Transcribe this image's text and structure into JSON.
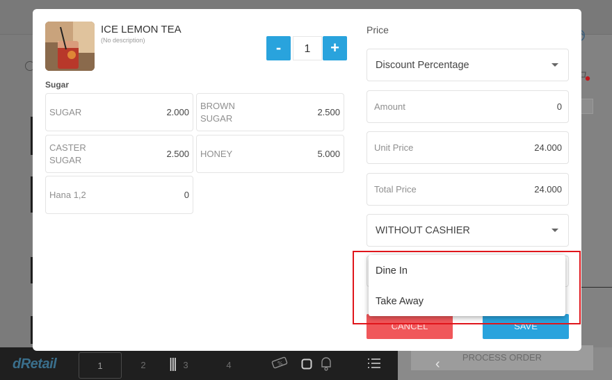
{
  "product": {
    "name": "ICE LEMON TEA",
    "description": "(No description)",
    "quantity": "1",
    "minus": "-",
    "plus": "+"
  },
  "option_group": {
    "label": "Sugar",
    "options": [
      {
        "name": "SUGAR",
        "price": "2.000"
      },
      {
        "name": "BROWN SUGAR",
        "price": "2.500"
      },
      {
        "name": "CASTER SUGAR",
        "price": "2.500"
      },
      {
        "name": "HONEY",
        "price": "5.000"
      },
      {
        "name": "Hana 1,2",
        "price": "0"
      }
    ]
  },
  "price_panel": {
    "label": "Price",
    "discount_type": "Discount Percentage",
    "amount_label": "Amount",
    "amount_value": "0",
    "unit_price_label": "Unit Price",
    "unit_price_value": "24.000",
    "total_price_label": "Total Price",
    "total_price_value": "24.000",
    "cashier_select": "WITHOUT CASHIER"
  },
  "order_type_dropdown": {
    "options": [
      "Dine In",
      "Take Away"
    ]
  },
  "actions": {
    "cancel": "CANCEL",
    "save": "SAVE"
  },
  "bottom_bar": {
    "brand": "dRetail",
    "pages": [
      "1",
      "2",
      "3",
      "4"
    ],
    "process_order": "PROCESS ORDER"
  },
  "colors": {
    "accent_blue": "#29a3dd",
    "cancel_red": "#f0575a",
    "highlight_red": "#e0151b"
  }
}
